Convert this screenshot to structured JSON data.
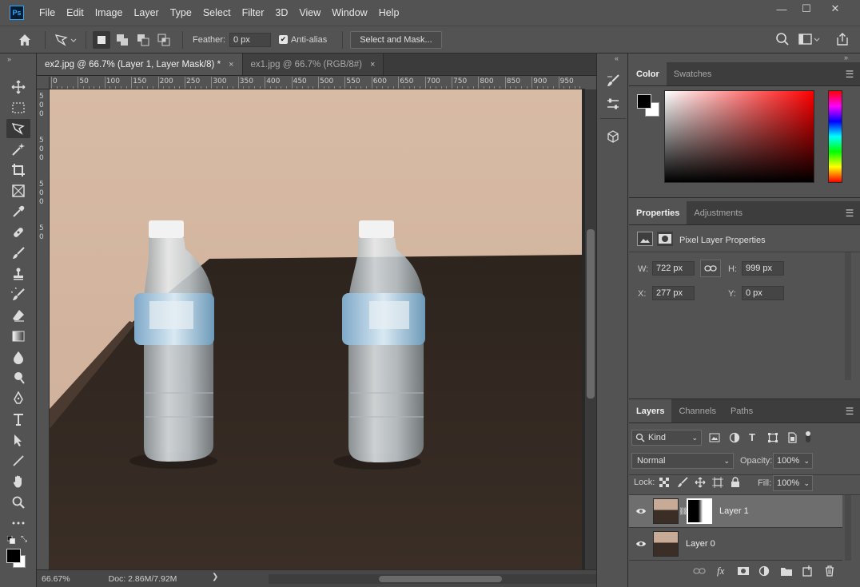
{
  "app": {
    "logo": "Ps"
  },
  "menu": [
    "File",
    "Edit",
    "Image",
    "Layer",
    "Type",
    "Select",
    "Filter",
    "3D",
    "View",
    "Window",
    "Help"
  ],
  "window_controls": {
    "minimize": "—",
    "maximize": "☐",
    "close": "✕"
  },
  "options": {
    "feather_label": "Feather:",
    "feather_value": "0 px",
    "antialias_label": "Anti-alias",
    "antialias_checked": true,
    "select_mask_label": "Select and Mask..."
  },
  "tabs": [
    {
      "label": "ex2.jpg @ 66.7% (Layer 1, Layer Mask/8) *",
      "close": "×",
      "active": true
    },
    {
      "label": "ex1.jpg @ 66.7% (RGB/8#)",
      "close": "×",
      "active": false
    }
  ],
  "ruler": {
    "top_labels": [
      "0",
      "50",
      "100",
      "150",
      "200",
      "250",
      "300",
      "350",
      "400",
      "450",
      "500",
      "550",
      "600",
      "650",
      "700",
      "750",
      "800",
      "850",
      "900",
      "950"
    ],
    "left_labels": [
      "5",
      "0",
      "0",
      "5",
      "0",
      "0",
      "5",
      "0",
      "0",
      "5",
      "0"
    ]
  },
  "status": {
    "zoom": "66.67%",
    "doc": "Doc: 2.86M/7.92M",
    "arrow": "❯"
  },
  "color_panel": {
    "tabs": [
      "Color",
      "Swatches"
    ],
    "foreground": "#000000",
    "background": "#ffffff",
    "hue_color": "#ff0000"
  },
  "properties_panel": {
    "tabs": [
      "Properties",
      "Adjustments"
    ],
    "title": "Pixel Layer Properties",
    "w_label": "W:",
    "w_value": "722 px",
    "h_label": "H:",
    "h_value": "999 px",
    "x_label": "X:",
    "x_value": "277 px",
    "y_label": "Y:",
    "y_value": "0 px"
  },
  "layers_panel": {
    "tabs": [
      "Layers",
      "Channels",
      "Paths"
    ],
    "filter_kind": "Kind",
    "blend_mode": "Normal",
    "opacity_label": "Opacity:",
    "opacity_value": "100%",
    "lock_label": "Lock:",
    "fill_label": "Fill:",
    "fill_value": "100%",
    "layers": [
      {
        "name": "Layer 1",
        "selected": true,
        "has_mask": true
      },
      {
        "name": "Layer 0",
        "selected": false,
        "has_mask": false
      }
    ]
  }
}
